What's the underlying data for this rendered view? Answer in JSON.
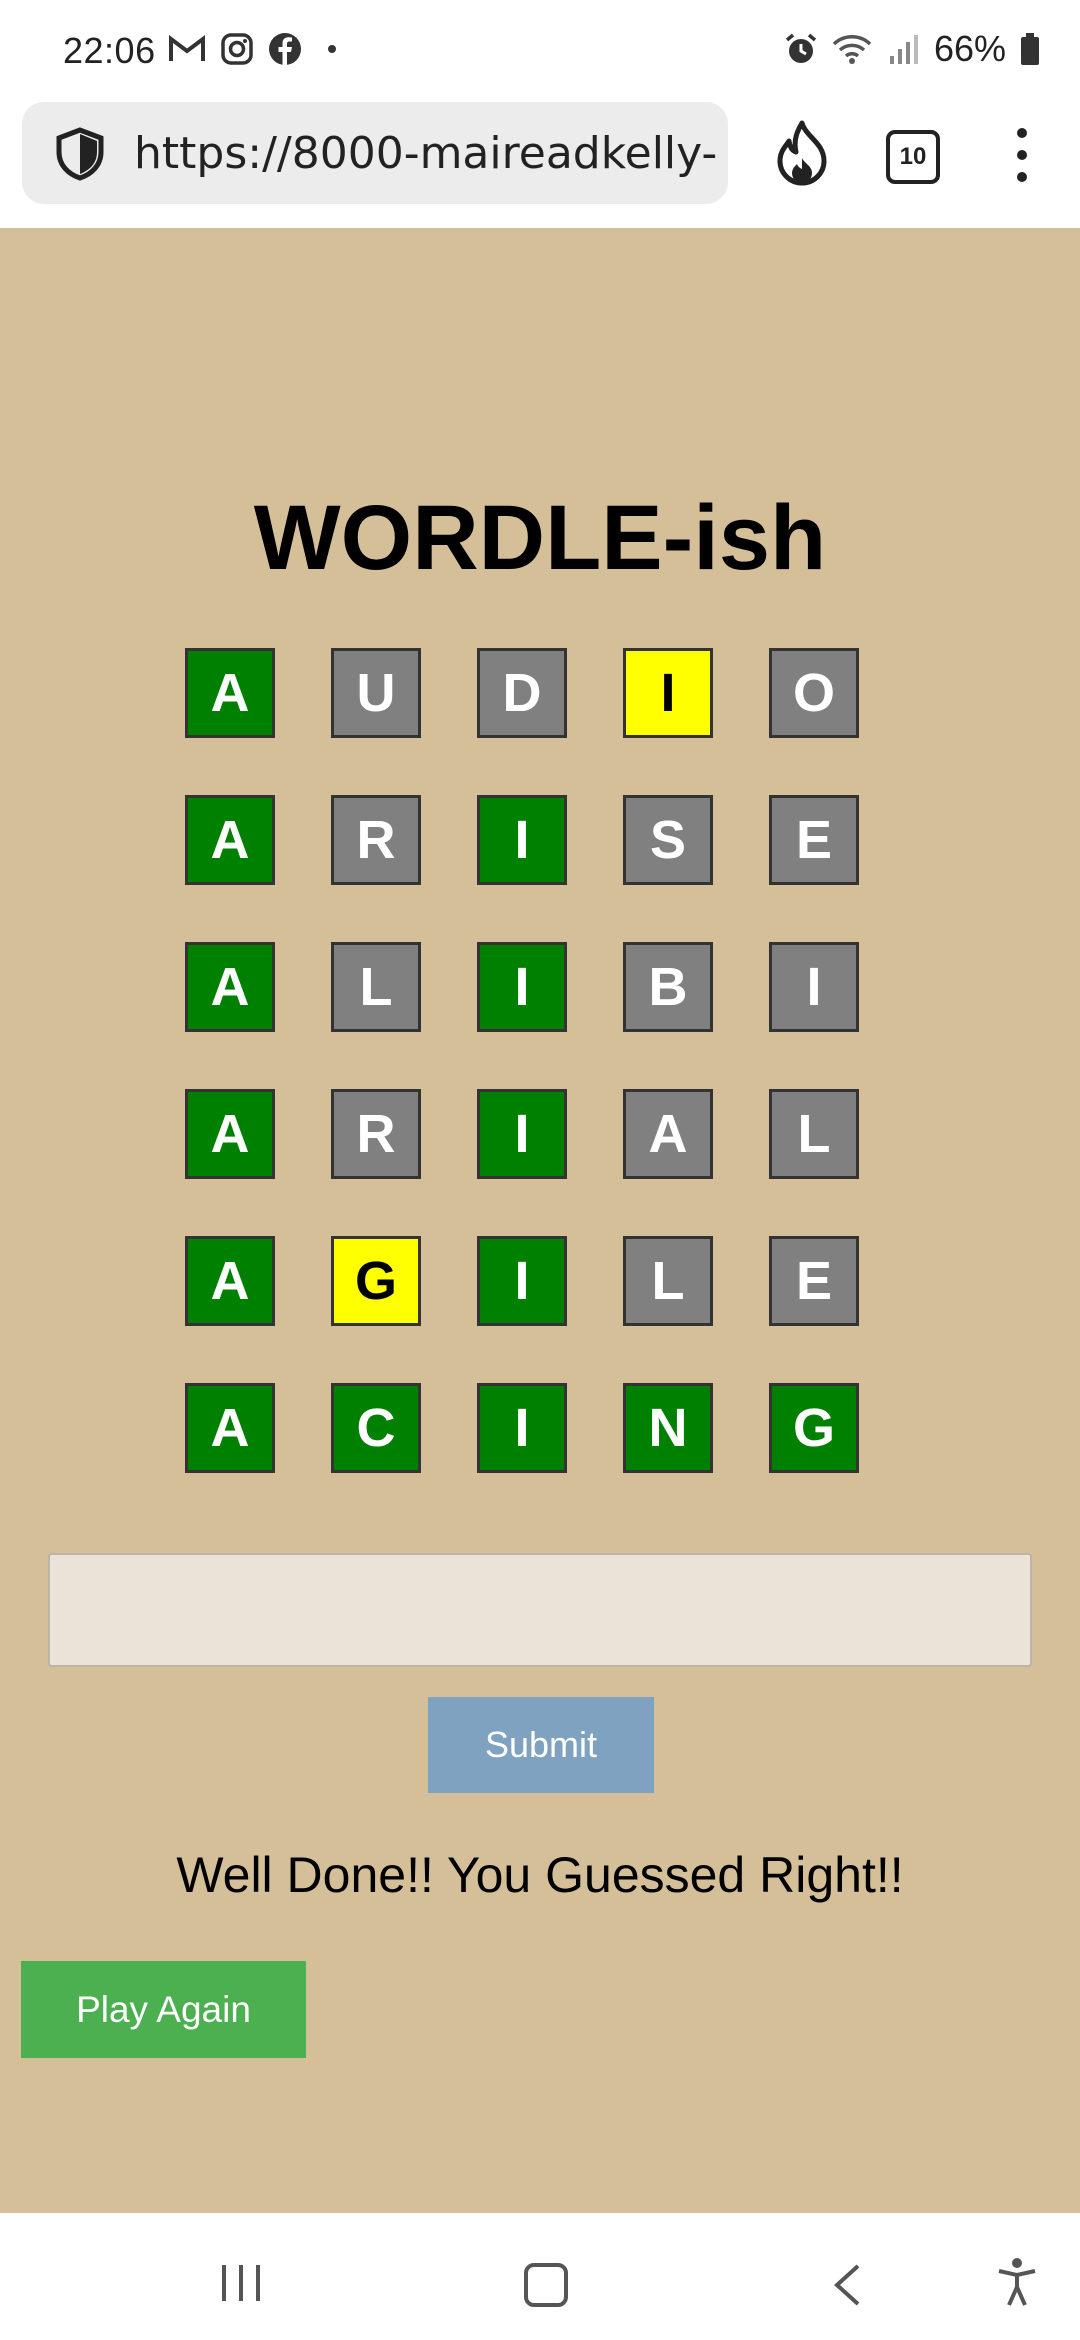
{
  "status_bar": {
    "time": "22:06",
    "left_icons": [
      "gmail-icon",
      "instagram-icon",
      "facebook-icon",
      "dot-icon"
    ],
    "right_icons": [
      "alarm-icon",
      "wifi-icon",
      "signal-icon",
      "battery-icon"
    ],
    "battery": "66%"
  },
  "browser": {
    "url": "https://8000-maireadkelly-",
    "tab_count": "10"
  },
  "game": {
    "title": "WORDLE-ish",
    "rows": [
      [
        {
          "letter": "A",
          "state": "green"
        },
        {
          "letter": "U",
          "state": "gray"
        },
        {
          "letter": "D",
          "state": "gray"
        },
        {
          "letter": "I",
          "state": "yellow"
        },
        {
          "letter": "O",
          "state": "gray"
        }
      ],
      [
        {
          "letter": "A",
          "state": "green"
        },
        {
          "letter": "R",
          "state": "gray"
        },
        {
          "letter": "I",
          "state": "green"
        },
        {
          "letter": "S",
          "state": "gray"
        },
        {
          "letter": "E",
          "state": "gray"
        }
      ],
      [
        {
          "letter": "A",
          "state": "green"
        },
        {
          "letter": "L",
          "state": "gray"
        },
        {
          "letter": "I",
          "state": "green"
        },
        {
          "letter": "B",
          "state": "gray"
        },
        {
          "letter": "I",
          "state": "gray"
        }
      ],
      [
        {
          "letter": "A",
          "state": "green"
        },
        {
          "letter": "R",
          "state": "gray"
        },
        {
          "letter": "I",
          "state": "green"
        },
        {
          "letter": "A",
          "state": "gray"
        },
        {
          "letter": "L",
          "state": "gray"
        }
      ],
      [
        {
          "letter": "A",
          "state": "green"
        },
        {
          "letter": "G",
          "state": "yellow"
        },
        {
          "letter": "I",
          "state": "green"
        },
        {
          "letter": "L",
          "state": "gray"
        },
        {
          "letter": "E",
          "state": "gray"
        }
      ],
      [
        {
          "letter": "A",
          "state": "green"
        },
        {
          "letter": "C",
          "state": "green"
        },
        {
          "letter": "I",
          "state": "green"
        },
        {
          "letter": "N",
          "state": "green"
        },
        {
          "letter": "G",
          "state": "green"
        }
      ]
    ],
    "input_value": "",
    "submit_label": "Submit",
    "message": "Well Done!! You Guessed Right!!",
    "play_again_label": "Play Again"
  },
  "colors": {
    "background": "#d4bf99",
    "green": "#008000",
    "gray": "#808080",
    "yellow": "#ffff00",
    "submit": "#7fa2c0",
    "play_again": "#4caf50"
  }
}
